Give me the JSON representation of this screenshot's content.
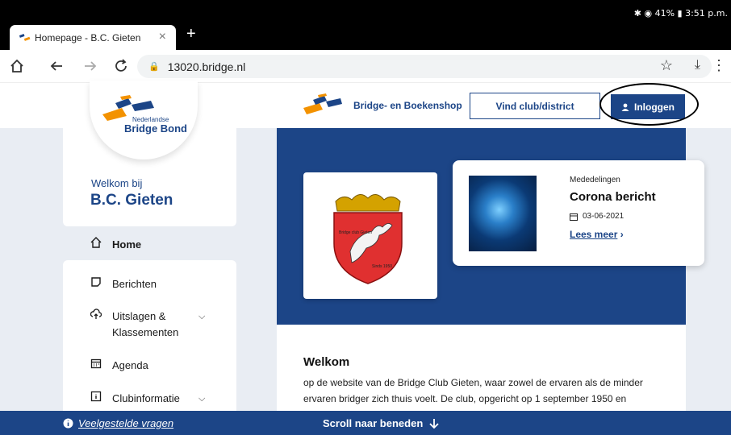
{
  "status": {
    "text": "✱ ◉ 41% ▮ 3:51 p.m."
  },
  "browser": {
    "tab_title": "Homepage - B.C. Gieten",
    "tab_close": "×",
    "new_tab": "+",
    "url": "13020.bridge.nl"
  },
  "site": {
    "logo_top": "Nederlandse",
    "logo_bottom": "Bridge Bond",
    "shop_label": "Bridge- en Boekenshop",
    "find_club_label": "Vind club/district",
    "login_label": "Inloggen"
  },
  "sidebar": {
    "welcome": "Welkom bij",
    "club_name": "B.C. Gieten",
    "items": [
      {
        "label": "Home",
        "icon": "home-icon"
      },
      {
        "label": "Berichten",
        "icon": "note-icon"
      },
      {
        "label": "Uitslagen &",
        "label2": "Klassementen",
        "icon": "cloud-upload-icon"
      },
      {
        "label": "Agenda",
        "icon": "calendar-icon"
      },
      {
        "label": "Clubinformatie",
        "icon": "info-icon"
      }
    ]
  },
  "news": {
    "category": "Mededelingen",
    "title": "Corona bericht",
    "date": "03-06-2021",
    "read_more": "Lees meer"
  },
  "crest": {
    "caption_top": "Bridge club Gieten",
    "caption_bottom": "Sinds 1950"
  },
  "welcome_section": {
    "heading": "Welkom",
    "line1": "op de website van de Bridge Club Gieten, waar zowel de ervaren als de minder",
    "line2": "ervaren bridger zich thuis voelt. De club, opgericht op 1 september 1950 en"
  },
  "bottom_bar": {
    "faq_label": "Veelgestelde vragen",
    "scroll_label": "Scroll naar beneden"
  },
  "colors": {
    "brand_blue": "#1c4587",
    "accent_orange": "#f39200"
  }
}
